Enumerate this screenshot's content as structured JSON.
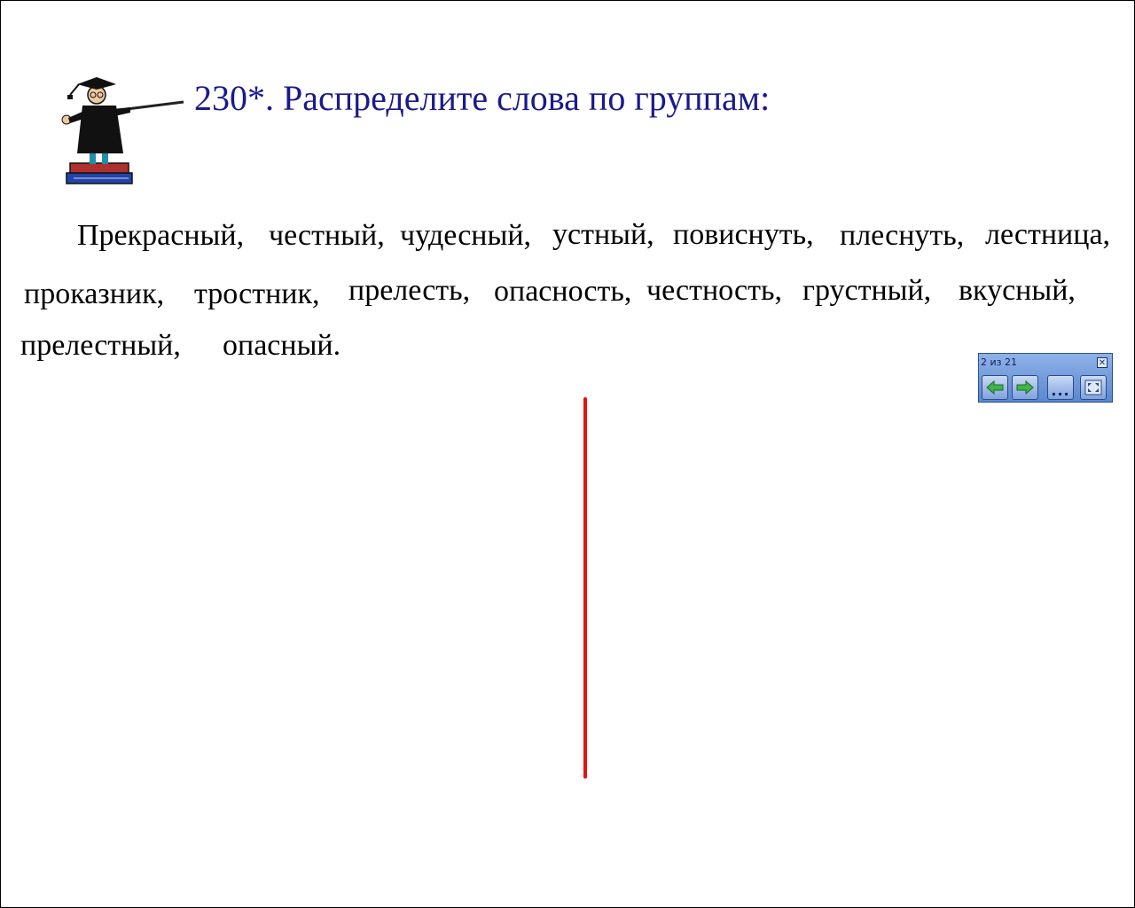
{
  "slide": {
    "title": "230*. Распределите слова по группам:",
    "words": [
      "Прекрасный,",
      "честный,",
      "чудесный,",
      "устный,",
      "повиснуть,",
      "плеснуть,",
      "лестница,",
      "проказник,",
      "тростник,",
      "прелесть,",
      "опасность,",
      "честность,",
      "грустный,",
      "вкусный,",
      "прелестный,",
      "опасный."
    ]
  },
  "toolbar": {
    "counter": "2 из 21",
    "close_icon": "close-icon",
    "prev_icon": "arrow-left-icon",
    "next_icon": "arrow-right-icon",
    "menu_label": "...",
    "fullscreen_icon": "fullscreen-icon"
  },
  "colors": {
    "title": "#1a1a8c",
    "text": "#000000",
    "divider": "#e81010",
    "toolbar": "#6f97d9"
  }
}
